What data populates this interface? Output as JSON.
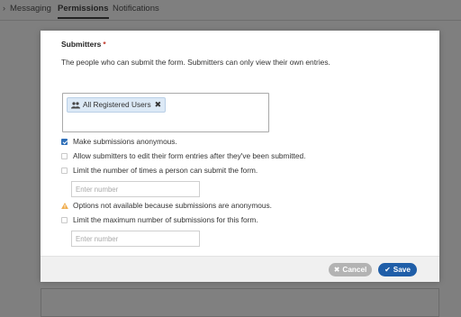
{
  "background": {
    "tabs": [
      {
        "label": "Messaging",
        "active": false
      },
      {
        "label": "Permissions",
        "active": true
      },
      {
        "label": "Notifications",
        "active": false
      }
    ]
  },
  "modal": {
    "title": "Submitters",
    "required_marker": "*",
    "description": "The people who can submit the form. Submitters can only view their own entries.",
    "selected_chip": {
      "label": "All Registered Users",
      "icon": "users-icon"
    },
    "options": [
      {
        "label": "Make submissions anonymous.",
        "checked": true
      },
      {
        "label": "Allow submitters to edit their form entries after they've been submitted.",
        "checked": false
      },
      {
        "label": "Limit the number of times a person can submit the form.",
        "checked": false
      },
      {
        "label": "Limit the maximum number of submissions for this form.",
        "checked": false
      }
    ],
    "limit_times_input": {
      "placeholder": "Enter number",
      "value": ""
    },
    "warning": "Options not available because submissions are anonymous.",
    "max_submissions_input": {
      "placeholder": "Enter number",
      "value": ""
    },
    "footer": {
      "cancel_label": "Cancel",
      "save_label": "Save"
    }
  },
  "colors": {
    "primary": "#1f5ea8",
    "cancel": "#b3b3b3",
    "warning": "#f0ad4e",
    "required": "#c0392b"
  }
}
